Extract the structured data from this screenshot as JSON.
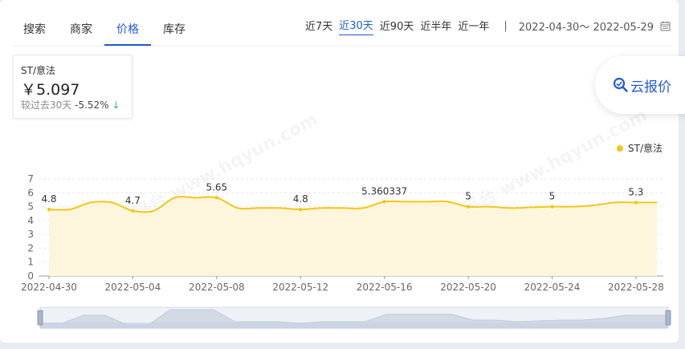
{
  "tabs": [
    {
      "label": "搜索"
    },
    {
      "label": "商家"
    },
    {
      "label": "价格"
    },
    {
      "label": "库存"
    }
  ],
  "active_tab": 2,
  "ranges": [
    {
      "label": "近7天"
    },
    {
      "label": "近30天"
    },
    {
      "label": "近90天"
    },
    {
      "label": "近半年"
    },
    {
      "label": "近一年"
    }
  ],
  "active_range": 1,
  "range_separator": "|",
  "date_range": "2022-04-30～ 2022-05-29",
  "icons": {
    "calendar": "calendar-icon",
    "search": "search-icon",
    "down_arrow": "arrow-down-icon"
  },
  "price_card": {
    "name": "ST/意法",
    "price": "￥5.097",
    "change_label": "较过去30天",
    "change_pct": "-5.52%",
    "change_arrow": "↓"
  },
  "quote_button": {
    "label": "云报价"
  },
  "watermark": "华强云平台 www.hqyun.com",
  "colors": {
    "accent": "#1f5bd6",
    "series": "#f5c518",
    "area": "#fdf6dc",
    "down": "#2ebd6b"
  },
  "chart_data": {
    "type": "line",
    "title": "",
    "xlabel": "",
    "ylabel": "",
    "ylim": [
      0,
      7
    ],
    "yticks": [
      0,
      1,
      2,
      3,
      4,
      5,
      6,
      7
    ],
    "x": [
      "2022-04-30",
      "2022-05-01",
      "2022-05-02",
      "2022-05-03",
      "2022-05-04",
      "2022-05-05",
      "2022-05-06",
      "2022-05-07",
      "2022-05-08",
      "2022-05-09",
      "2022-05-10",
      "2022-05-11",
      "2022-05-12",
      "2022-05-13",
      "2022-05-14",
      "2022-05-15",
      "2022-05-16",
      "2022-05-17",
      "2022-05-18",
      "2022-05-19",
      "2022-05-20",
      "2022-05-21",
      "2022-05-22",
      "2022-05-23",
      "2022-05-24",
      "2022-05-25",
      "2022-05-26",
      "2022-05-27",
      "2022-05-28",
      "2022-05-29"
    ],
    "xtick_labels": [
      "2022-04-30",
      "2022-05-04",
      "2022-05-08",
      "2022-05-12",
      "2022-05-16",
      "2022-05-20",
      "2022-05-24",
      "2022-05-28"
    ],
    "legend": "top-right",
    "grid": true,
    "area_fill": true,
    "series": [
      {
        "name": "ST/意法",
        "values": [
          4.8,
          4.8,
          5.3,
          5.3,
          4.7,
          4.7,
          5.65,
          5.65,
          5.65,
          4.9,
          4.9,
          4.9,
          4.8,
          4.9,
          4.9,
          4.9,
          5.360337,
          5.36,
          5.36,
          5.36,
          5,
          5,
          4.9,
          4.95,
          5,
          5,
          5.1,
          5.3,
          5.3,
          5.3
        ]
      }
    ],
    "point_labels": [
      {
        "index": 0,
        "text": "4.8"
      },
      {
        "index": 4,
        "text": "4.7"
      },
      {
        "index": 8,
        "text": "5.65"
      },
      {
        "index": 12,
        "text": "4.8"
      },
      {
        "index": 16,
        "text": "5.360337"
      },
      {
        "index": 20,
        "text": "5"
      },
      {
        "index": 24,
        "text": "5"
      },
      {
        "index": 28,
        "text": "5.3"
      }
    ]
  }
}
